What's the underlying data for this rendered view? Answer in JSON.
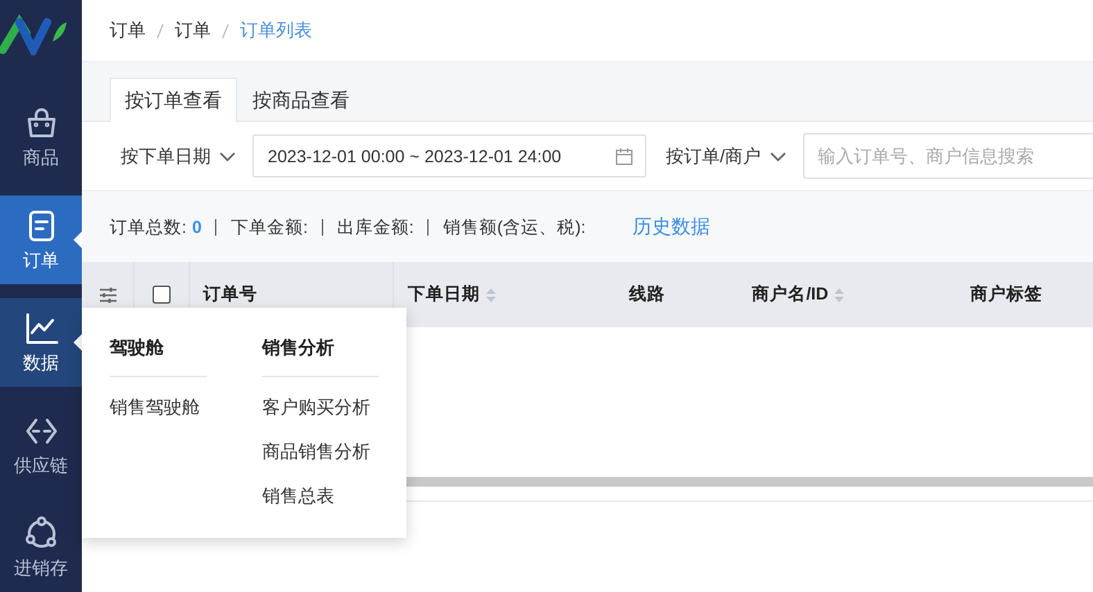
{
  "sidebar": {
    "items": [
      {
        "label": "商品",
        "selected": false,
        "expanded": false
      },
      {
        "label": "订单",
        "selected": true,
        "expanded": false
      },
      {
        "label": "数据",
        "selected": false,
        "expanded": true
      },
      {
        "label": "供应链",
        "selected": false,
        "expanded": false
      },
      {
        "label": "进销存",
        "selected": false,
        "expanded": false
      }
    ]
  },
  "breadcrumb": [
    "订单",
    "订单",
    "订单列表"
  ],
  "tabs": [
    {
      "label": "按订单查看",
      "selected": true
    },
    {
      "label": "按商品查看",
      "selected": false
    }
  ],
  "filters": {
    "date_mode": "按下单日期",
    "date_range": "2023-12-01 00:00 ~ 2023-12-01 24:00",
    "search_mode": "按订单/商户",
    "search": {
      "placeholder": "输入订单号、商户信息搜索"
    }
  },
  "summary": {
    "items": [
      {
        "label": "订单总数:",
        "value": "0"
      },
      {
        "label": "下单金额:"
      },
      {
        "label": "出库金额:"
      },
      {
        "label": "销售额(含运、税):"
      }
    ],
    "link": "历史数据"
  },
  "table": {
    "select_all": {
      "checked": false
    },
    "columns": [
      {
        "label": "订单号",
        "sortable": false
      },
      {
        "label": "下单日期",
        "sortable": true
      },
      {
        "label": "线路",
        "sortable": false
      },
      {
        "label": "商户名/ID",
        "sortable": true
      },
      {
        "label": "商户标签",
        "sortable": false
      }
    ]
  },
  "data_menu": {
    "groups": [
      {
        "title": "驾驶舱",
        "items": [
          "销售驾驶舱"
        ]
      },
      {
        "title": "销售分析",
        "items": [
          "客户购买分析",
          "商品销售分析",
          "销售总表"
        ]
      }
    ]
  }
}
